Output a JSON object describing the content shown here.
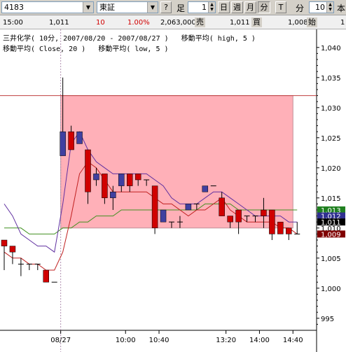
{
  "toolbar": {
    "code": "4183",
    "market": "東証",
    "help": "?",
    "ashi_label": "足",
    "period_value": "1",
    "day_btn": "日",
    "week_btn": "週",
    "month_btn": "月",
    "minute_btn": "分",
    "tick_btn": "T",
    "minute_label": "分",
    "minute_value": "10",
    "book_btn": "本"
  },
  "quote": {
    "time": "15:00",
    "price": "1,011",
    "change": "10",
    "change_pct": "1.00%",
    "volume": "2,063,000",
    "sell_label": "売",
    "sell": "1,011",
    "buy_label": "買",
    "buy": "1,008",
    "open_label": "始",
    "open": "1"
  },
  "legend": {
    "line1": "三井化学( 10分, 2007/08/20 - 2007/08/27 )   移動平均( high, 5 )",
    "line2": "移動平均( Close, 20 )   移動平均( low, 5 )"
  },
  "colors": {
    "up": "#d00000",
    "down": "#4040a0",
    "highlight": "#ffb0b8",
    "ma_high": "#6030a0",
    "ma_close": "#409020",
    "ma_low": "#c02020",
    "resistance": "#c04040"
  },
  "y_axis": {
    "ticks": [
      "1,040",
      "1,035",
      "1,030",
      "1,025",
      "1,020",
      "1,015",
      "1,010",
      "1,005",
      "1,000",
      "995"
    ],
    "markers": [
      {
        "label": "1,013",
        "color": "#208020",
        "text_color": "#ffffff"
      },
      {
        "label": "1,012",
        "color": "#303090",
        "text_color": "#ffffff"
      },
      {
        "label": "1,011",
        "color": "#000000",
        "text_color": "#ffffff"
      },
      {
        "label": "1,009",
        "color": "#800000",
        "text_color": "#ffffff"
      }
    ]
  },
  "x_axis": {
    "ticks": [
      "08/27",
      "10:00",
      "10:40",
      "13:20",
      "14:00",
      "14:40"
    ]
  },
  "chart_data": {
    "type": "candlestick",
    "y_range": [
      993,
      1043
    ],
    "resistance_level": 1032,
    "candles": [
      {
        "o": 1008,
        "h": 1008,
        "l": 1003,
        "c": 1007
      },
      {
        "o": 1007,
        "h": 1007,
        "l": 1004,
        "c": 1006
      },
      {
        "o": 1004,
        "h": 1005,
        "l": 1002,
        "c": 1004
      },
      {
        "o": 1004,
        "h": 1004,
        "l": 1003,
        "c": 1004
      },
      {
        "o": 1004,
        "h": 1004,
        "l": 1003,
        "c": 1004
      },
      {
        "o": 1003,
        "h": 1003,
        "l": 1001,
        "c": 1001
      },
      {
        "o": 1001,
        "h": 1001,
        "l": 1001,
        "c": 1001
      },
      {
        "o": 1022,
        "h": 1035,
        "l": 1022,
        "c": 1026
      },
      {
        "o": 1026,
        "h": 1027,
        "l": 1023,
        "c": 1023
      },
      {
        "o": 1024,
        "h": 1026,
        "l": 1024,
        "c": 1026
      },
      {
        "o": 1023,
        "h": 1023,
        "l": 1014,
        "c": 1016
      },
      {
        "o": 1018,
        "h": 1020,
        "l": 1017,
        "c": 1019
      },
      {
        "o": 1019,
        "h": 1019,
        "l": 1014,
        "c": 1015
      },
      {
        "o": 1015,
        "h": 1017,
        "l": 1013,
        "c": 1016
      },
      {
        "o": 1017,
        "h": 1019,
        "l": 1016,
        "c": 1019
      },
      {
        "o": 1019,
        "h": 1019,
        "l": 1016,
        "c": 1017
      },
      {
        "o": 1019,
        "h": 1019,
        "l": 1017,
        "c": 1018
      },
      {
        "o": 1018,
        "h": 1018,
        "l": 1017,
        "c": 1018
      },
      {
        "o": 1017,
        "h": 1017,
        "l": 1009,
        "c": 1010
      },
      {
        "o": 1011,
        "h": 1013,
        "l": 1011,
        "c": 1013
      },
      {
        "o": 1011,
        "h": 1011,
        "l": 1010,
        "c": 1011
      },
      {
        "o": 1011,
        "h": 1012,
        "l": 1010,
        "c": 1011
      },
      {
        "o": 1013,
        "h": 1014,
        "l": 1013,
        "c": 1014
      },
      {
        "o": 1014,
        "h": 1014,
        "l": 1013,
        "c": 1014
      },
      {
        "o": 1016,
        "h": 1017,
        "l": 1016,
        "c": 1017
      },
      {
        "o": 1017,
        "h": 1017,
        "l": 1017,
        "c": 1017
      },
      {
        "o": 1015,
        "h": 1016,
        "l": 1012,
        "c": 1012
      },
      {
        "o": 1012,
        "h": 1012,
        "l": 1010,
        "c": 1011
      },
      {
        "o": 1013,
        "h": 1013,
        "l": 1009,
        "c": 1011
      },
      {
        "o": 1012,
        "h": 1012,
        "l": 1011,
        "c": 1012
      },
      {
        "o": 1012,
        "h": 1012,
        "l": 1011,
        "c": 1012
      },
      {
        "o": 1013,
        "h": 1015,
        "l": 1010,
        "c": 1012
      },
      {
        "o": 1013,
        "h": 1013,
        "l": 1008,
        "c": 1009
      },
      {
        "o": 1011,
        "h": 1011,
        "l": 1009,
        "c": 1009
      },
      {
        "o": 1010,
        "h": 1010,
        "l": 1008,
        "c": 1009
      },
      {
        "o": 1009,
        "h": 1011,
        "l": 1009,
        "c": 1009
      }
    ],
    "ma_high_5": [
      1014,
      1012,
      1009,
      1008,
      1007,
      1007,
      1006,
      1014,
      1024,
      1026,
      1023,
      1021,
      1020,
      1019,
      1019,
      1019,
      1019,
      1019,
      1018,
      1017,
      1015,
      1014,
      1014,
      1014,
      1015,
      1016,
      1016,
      1015,
      1014,
      1013,
      1012,
      1012,
      1012,
      1012,
      1011,
      1011
    ],
    "ma_close_20": [
      1010,
      1010,
      1010,
      1009,
      1009,
      1009,
      1009,
      1010,
      1010,
      1011,
      1011,
      1012,
      1012,
      1012,
      1013,
      1013,
      1013,
      1013,
      1013,
      1013,
      1013,
      1013,
      1013,
      1013,
      1014,
      1014,
      1014,
      1014,
      1013,
      1013,
      1013,
      1013,
      1013,
      1013,
      1013,
      1013
    ],
    "ma_low_5": [
      1006,
      1005,
      1005,
      1004,
      1004,
      1003,
      1003,
      1006,
      1012,
      1019,
      1021,
      1020,
      1018,
      1016,
      1016,
      1016,
      1016,
      1016,
      1015,
      1014,
      1014,
      1013,
      1012,
      1013,
      1013,
      1014,
      1015,
      1013,
      1012,
      1011,
      1011,
      1011,
      1011,
      1010,
      1010,
      1009
    ]
  }
}
